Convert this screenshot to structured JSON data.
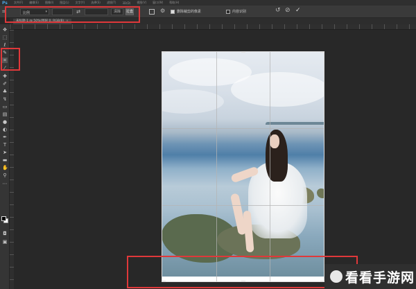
{
  "menubar": {
    "logo": "Ps",
    "items": [
      "文件(F)",
      "编辑(E)",
      "图像(I)",
      "图层(L)",
      "文字(Y)",
      "选择(S)",
      "滤镜(T)",
      "3D(D)",
      "视图(V)",
      "窗口(W)",
      "帮助(H)"
    ]
  },
  "options_bar": {
    "ratio_value": "比例",
    "width_value": "",
    "height_value": "",
    "clear_label": "清除",
    "straighten_label": "拉直",
    "delete_cropped_label": "删除裁剪的像素",
    "delete_cropped_checked": true,
    "content_aware_label": "内容识别",
    "content_aware_checked": false
  },
  "document_tab": {
    "title": "未标题-1 @ 50%(图层 0, RGB/8)",
    "close_glyph": "×"
  },
  "watermark": {
    "text": "看看手游网"
  },
  "colors": {
    "highlight": "#e0383a",
    "canvas_bg": "#282828",
    "panel_bg": "#353535"
  },
  "icons": {
    "tools": [
      "move-tool-icon",
      "marquee-tool-icon",
      "lasso-tool-icon",
      "quick-select-tool-icon",
      "crop-tool-icon",
      "eyedropper-tool-icon",
      "healing-brush-tool-icon",
      "brush-tool-icon",
      "clone-stamp-tool-icon",
      "history-brush-tool-icon",
      "eraser-tool-icon",
      "gradient-tool-icon",
      "blur-tool-icon",
      "dodge-tool-icon",
      "pen-tool-icon",
      "type-tool-icon",
      "path-select-tool-icon",
      "shape-tool-icon",
      "hand-tool-icon",
      "zoom-tool-icon"
    ]
  }
}
